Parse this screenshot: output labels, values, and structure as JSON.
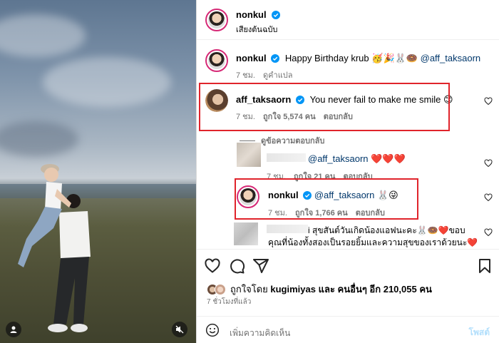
{
  "post_header": {
    "username": "nonkul",
    "subtitle": "เสียงต้นฉบับ"
  },
  "caption": {
    "username": "nonkul",
    "text": "Happy Birthday krub 🥳🎉🐰🍩",
    "mention": "@aff_taksaorn",
    "time": "7 ชม.",
    "translate": "ดูคำแปล"
  },
  "comment1": {
    "username": "aff_taksaorn",
    "text": "You never fail to make me smile 😊",
    "time": "7 ชม.",
    "likes": "ถูกใจ 5,574 คน",
    "reply": "ตอบกลับ"
  },
  "view_replies": "ดูข้อความตอบกลับ",
  "reply1": {
    "mention": "@aff_taksaorn",
    "text": "❤️❤️❤️",
    "time": "7 ชม.",
    "likes": "ถูกใจ 21 คน",
    "reply": "ตอบกลับ"
  },
  "reply2": {
    "username": "nonkul",
    "mention": "@aff_taksaorn",
    "text": "🐰😜",
    "time": "7 ชม.",
    "likes": "ถูกใจ 1,766 คน",
    "reply": "ตอบกลับ"
  },
  "reply3": {
    "line1": "i สุขสันต์วันเกิดน้องแอฟนะคะ🐰🍩❤️ขอบ",
    "line2": "คุณที่น้องทั้งสองเป็นรอยยิ้มและความสุขของเราด้วยนะ❤️"
  },
  "likes": {
    "prefix": "ถูกใจโดย",
    "user": "kugimiyas",
    "and": "และ",
    "others": "คนอื่นๆ อีก 210,055 คน"
  },
  "time_ago": "7 ชั่วโมงที่แล้ว",
  "add_comment": {
    "placeholder": "เพิ่มความคิดเห็น",
    "post": "โพสต์"
  },
  "colors": {
    "highlight": "#e0242b",
    "verified": "#0095f6",
    "ring": "#d62976"
  }
}
